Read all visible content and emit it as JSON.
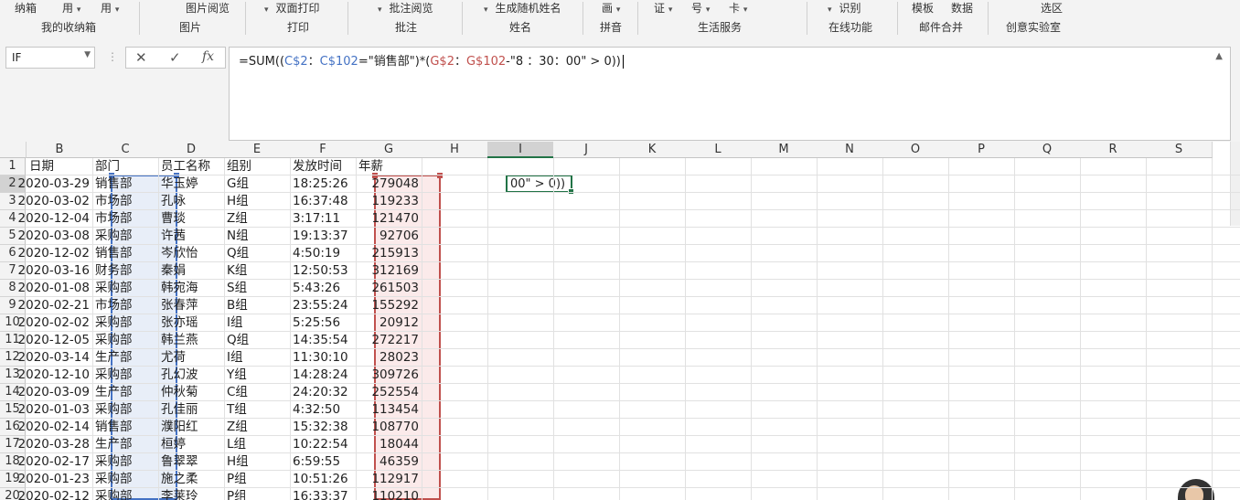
{
  "ribbon": {
    "top_labels": [
      {
        "text": "纳箱",
        "caret": false
      },
      {
        "text": "用",
        "caret": true
      },
      {
        "text": "用",
        "caret": true
      },
      {
        "text": "图片阅览",
        "caret": false
      },
      {
        "text": "双面打印",
        "caret": true
      },
      {
        "text": "批注阅览",
        "caret": true
      },
      {
        "text": "生成随机姓名",
        "caret": true
      },
      {
        "text": "画",
        "caret": true
      },
      {
        "text": "证",
        "caret": true
      },
      {
        "text": "号",
        "caret": true
      },
      {
        "text": "卡",
        "caret": true
      },
      {
        "text": "识别",
        "caret": true
      },
      {
        "text": "模板",
        "caret": false
      },
      {
        "text": "数据",
        "caret": false
      },
      {
        "text": "选区",
        "caret": false
      }
    ],
    "groups": [
      "我的收纳箱",
      "图片",
      "打印",
      "批注",
      "姓名",
      "拼音",
      "生活服务",
      "在线功能",
      "邮件合并",
      "创意实验室"
    ]
  },
  "formula_bar": {
    "name_box": "IF",
    "cancel_icon": "✕",
    "enter_icon": "✓",
    "fx_icon": "fx",
    "formula_parts": [
      {
        "t": "=SUM((",
        "c": "#222222"
      },
      {
        "t": "C$2",
        "c": "#4472c4"
      },
      {
        "t": "：",
        "c": "#222222"
      },
      {
        "t": "C$102",
        "c": "#4472c4"
      },
      {
        "t": "=\"销售部\")*(",
        "c": "#222222"
      },
      {
        "t": "G$2",
        "c": "#c0504d"
      },
      {
        "t": "：",
        "c": "#222222"
      },
      {
        "t": "G$102",
        "c": "#c0504d"
      },
      {
        "t": "-\"8 ：30：00\" > 0))",
        "c": "#222222"
      }
    ]
  },
  "columns": [
    "B",
    "C",
    "D",
    "E",
    "F",
    "G",
    "H",
    "I",
    "J",
    "K",
    "L",
    "M",
    "N",
    "O",
    "P",
    "Q",
    "R",
    "S"
  ],
  "rows": [
    "1",
    "2",
    "3",
    "4",
    "5",
    "6",
    "7",
    "8",
    "9",
    "10",
    "11",
    "12",
    "13",
    "14",
    "15",
    "16",
    "17",
    "18",
    "19",
    "20"
  ],
  "header_row": {
    "B": "日期",
    "C": "部门",
    "D": "员工名称",
    "E": "组别",
    "F": "发放时间",
    "G": "年薪"
  },
  "records": [
    {
      "B": "2020-03-29",
      "C": "销售部",
      "D": "华玉婷",
      "E": "G组",
      "F": "18:25:26",
      "G": "279048"
    },
    {
      "B": "2020-03-02",
      "C": "市场部",
      "D": "孔咏",
      "E": "H组",
      "F": "16:37:48",
      "G": "119233"
    },
    {
      "B": "2020-12-04",
      "C": "市场部",
      "D": "曹琰",
      "E": "Z组",
      "F": "3:17:11",
      "G": "121470"
    },
    {
      "B": "2020-03-08",
      "C": "采购部",
      "D": "许茜",
      "E": "N组",
      "F": "19:13:37",
      "G": "92706"
    },
    {
      "B": "2020-12-02",
      "C": "销售部",
      "D": "岑欣怡",
      "E": "Q组",
      "F": "4:50:19",
      "G": "215913"
    },
    {
      "B": "2020-03-16",
      "C": "财务部",
      "D": "秦娟",
      "E": "K组",
      "F": "12:50:53",
      "G": "312169"
    },
    {
      "B": "2020-01-08",
      "C": "采购部",
      "D": "韩宛海",
      "E": "S组",
      "F": "5:43:26",
      "G": "261503"
    },
    {
      "B": "2020-02-21",
      "C": "市场部",
      "D": "张春萍",
      "E": "B组",
      "F": "23:55:24",
      "G": "155292"
    },
    {
      "B": "2020-02-02",
      "C": "采购部",
      "D": "张亦瑶",
      "E": "I组",
      "F": "5:25:56",
      "G": "20912"
    },
    {
      "B": "2020-12-05",
      "C": "采购部",
      "D": "韩兰燕",
      "E": "Q组",
      "F": "14:35:54",
      "G": "272217"
    },
    {
      "B": "2020-03-14",
      "C": "生产部",
      "D": "尤荷",
      "E": "I组",
      "F": "11:30:10",
      "G": "28023"
    },
    {
      "B": "2020-12-10",
      "C": "采购部",
      "D": "孔幻波",
      "E": "Y组",
      "F": "14:28:24",
      "G": "309726"
    },
    {
      "B": "2020-03-09",
      "C": "生产部",
      "D": "仲秋菊",
      "E": "C组",
      "F": "24:20:32",
      "G": "252554"
    },
    {
      "B": "2020-01-03",
      "C": "采购部",
      "D": "孔佳丽",
      "E": "T组",
      "F": "4:32:50",
      "G": "113454"
    },
    {
      "B": "2020-02-14",
      "C": "销售部",
      "D": "濮阳红",
      "E": "Z组",
      "F": "15:32:38",
      "G": "108770"
    },
    {
      "B": "2020-03-28",
      "C": "生产部",
      "D": "桓婷",
      "E": "L组",
      "F": "10:22:54",
      "G": "18044"
    },
    {
      "B": "2020-02-17",
      "C": "采购部",
      "D": "鲁翠翠",
      "E": "H组",
      "F": "6:59:55",
      "G": "46359"
    },
    {
      "B": "2020-01-23",
      "C": "采购部",
      "D": "施之柔",
      "E": "P组",
      "F": "10:51:26",
      "G": "112917"
    },
    {
      "B": "2020-02-12",
      "C": "采购部",
      "D": "李莱玲",
      "E": "P组",
      "F": "16:33:37",
      "G": "110210"
    }
  ],
  "active_cell_text": "00\" > 0))",
  "colors": {
    "ref_blue": "#4472c4",
    "ref_red": "#c0504d",
    "accent_green": "#217346"
  }
}
